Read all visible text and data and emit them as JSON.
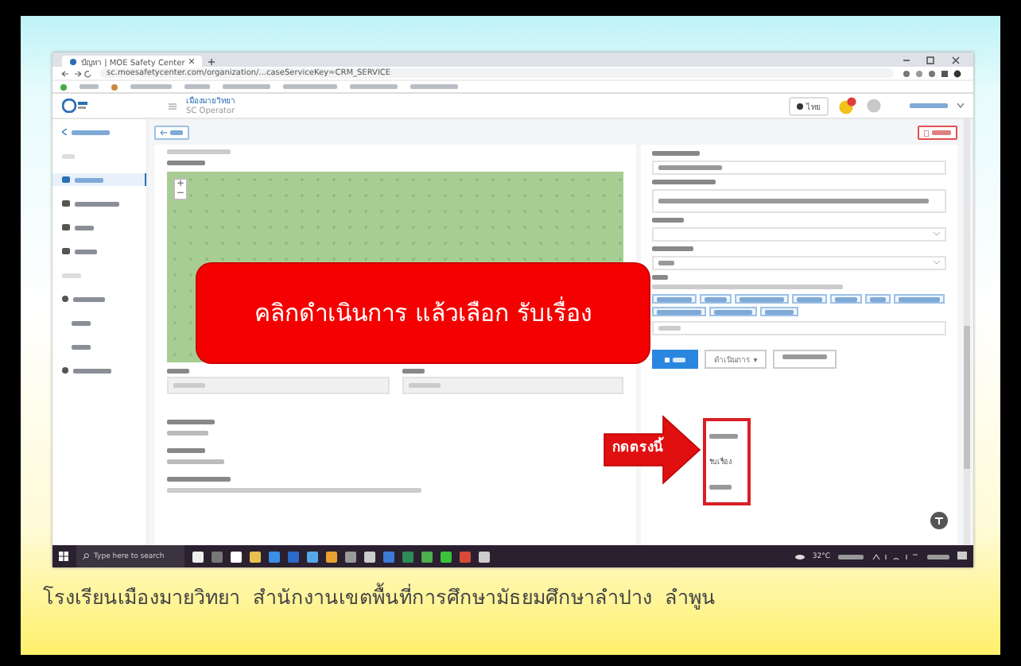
{
  "browser": {
    "tab_title": "ปัญหา | MOE Safety Center",
    "url": "sc.moesafetycenter.com/organization/...caseServiceKey=CRM_SERVICE"
  },
  "app_header": {
    "title": "เมืองมายวิทยา",
    "subtitle": "SC Operator",
    "language": "ไทย"
  },
  "sidebar": {
    "items": [
      {
        "selected": true
      },
      {
        "selected": false
      },
      {
        "selected": false
      },
      {
        "selected": false
      }
    ]
  },
  "map": {
    "zoom_in": "+",
    "zoom_out": "−"
  },
  "callout": "คลิกดำเนินการ แล้วเลือก รับเรื่อง",
  "action_button": "ดำเนินการ ▾",
  "action_menu": {
    "items": [
      "รับเรื่อง"
    ]
  },
  "pointer_label": "กดตรงนี้",
  "taskbar": {
    "search_placeholder": "Type here to search",
    "weather": "32°C"
  },
  "caption": "โรงเรียนเมืองมายวิทยา  สำนักงานเขตพื้นที่การศึกษามัธยมศึกษาลำปาง  ลำพูน"
}
